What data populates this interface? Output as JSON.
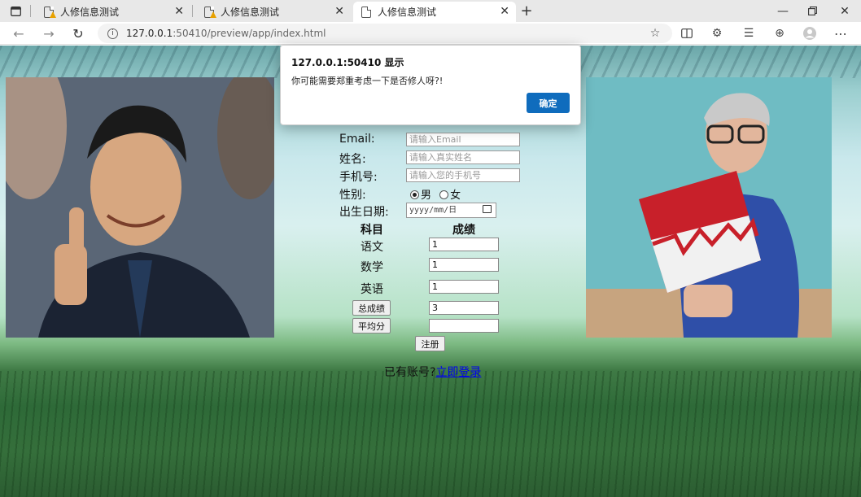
{
  "tabs": [
    {
      "title": "人修信息测试",
      "warning": true
    },
    {
      "title": "人修信息测试",
      "warning": true
    },
    {
      "title": "人修信息测试",
      "warning": false
    }
  ],
  "address": {
    "host": "127.0.0.1",
    "rest": ":50410/preview/app/index.html"
  },
  "form": {
    "labels": {
      "email": "Email:",
      "name": "姓名:",
      "phone": "手机号:",
      "gender": "性别:",
      "birthday": "出生日期:"
    },
    "placeholders": {
      "email": "请输入Email",
      "name": "请输入真实姓名",
      "phone": "请输入您的手机号",
      "date": "yyyy/mm/日"
    },
    "gender_options": {
      "male": "男",
      "female": "女",
      "selected": "男"
    },
    "scores_header": {
      "subject": "科目",
      "score": "成绩"
    },
    "subjects": [
      {
        "name": "语文",
        "score": "1"
      },
      {
        "name": "数学",
        "score": "1"
      },
      {
        "name": "英语",
        "score": "1"
      }
    ],
    "total_button": "总成绩",
    "total_value": "3",
    "avg_button": "平均分",
    "avg_value": "",
    "register_button": "注册",
    "login_prompt": "已有账号?",
    "login_link": "立即登录"
  },
  "dialog": {
    "title": "127.0.0.1:50410 显示",
    "message": "你可能需要郑重考虑一下是否修人呀?!",
    "ok_label": "确定"
  },
  "colors": {
    "accent": "#0f6cbd",
    "link": "#0000ee"
  }
}
